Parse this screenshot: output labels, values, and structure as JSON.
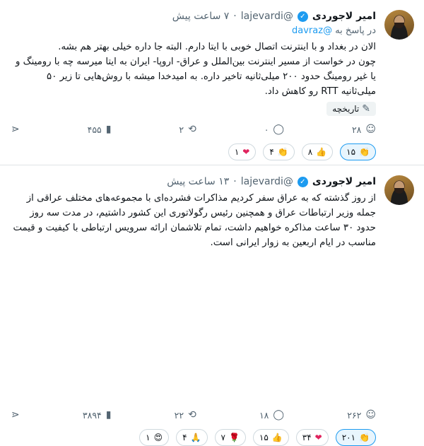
{
  "posts": [
    {
      "name": "امیر لاجوردی",
      "handle": "@lajevardi",
      "time": "۷ ساعت پیش",
      "replying_label": "در پاسخ به",
      "replying_to": "@davraz",
      "text": "الان در بغداد و با اینترنت اتصال خوبی با ایتا دارم. البته جا داره خیلی بهتر هم بشه.\nچون در خواست از مسیر اینترنت بین‌الملل و عراق- اروپا- ایران به ایتا میرسه چه با رومینگ و یا غیر رومینگ حدود ۲۰۰ میلی‌ثانیه تاخیر داره. به امیدخدا میشه با روش‌هایی تا زیر ۵۰ میلی‌ثانیه RTT رو کاهش داد.",
      "tag": "تاریخچه",
      "actions": {
        "reactions_count": "۲۸",
        "comments_count": "۰",
        "reposts_count": "۲",
        "views_count": "۴۵۵"
      },
      "reactions": [
        {
          "count": "۱۵",
          "emoji": "👏",
          "icon": "clap-reaction-icon"
        },
        {
          "count": "۸",
          "emoji": "👍",
          "icon": "thumbs-up-reaction-icon"
        },
        {
          "count": "۴",
          "emoji": "👏",
          "icon": "clap-reaction-icon"
        },
        {
          "count": "۱",
          "emoji": "❤",
          "icon": "heart-reaction-icon"
        }
      ]
    },
    {
      "name": "امیر لاجوردی",
      "handle": "@lajevardi",
      "time": "۱۳ ساعت پیش",
      "text": "از روز گذشته که به عراق سفر کردیم مذاکرات فشرده‌ای با مجموعه‌های مختلف عراقی از جمله وزیر ارتباطات عراق و همچنین رئیس رگولاتوری این کشور داشتیم، در مدت سه روز حدود ۳۰ ساعت مذاکره خواهیم داشت، تمام تلاشمان ارائه سرویس ارتباطی با کیفیت و قیمت مناسب در ایام اربعین به زوار ایرانی است.",
      "actions": {
        "reactions_count": "۲۶۲",
        "comments_count": "۱۸",
        "reposts_count": "۲۲",
        "views_count": "۳۸۹۴"
      },
      "reactions": [
        {
          "count": "۲۰۱",
          "emoji": "👏",
          "icon": "clap-reaction-icon"
        },
        {
          "count": "۳۴",
          "emoji": "❤",
          "icon": "heart-reaction-icon"
        },
        {
          "count": "۱۵",
          "emoji": "👍",
          "icon": "thumbs-up-reaction-icon"
        },
        {
          "count": "۷",
          "emoji": "🌹",
          "icon": "rose-reaction-icon"
        },
        {
          "count": "۴",
          "emoji": "🙏",
          "icon": "pray-reaction-icon"
        },
        {
          "count": "۱",
          "emoji": "😍",
          "icon": "heart-eyes-reaction-icon"
        }
      ]
    }
  ],
  "colors": {
    "accent": "#1d9bf0",
    "muted_text": "#536471",
    "text": "#0f1419",
    "divider": "#dfe3e6"
  }
}
